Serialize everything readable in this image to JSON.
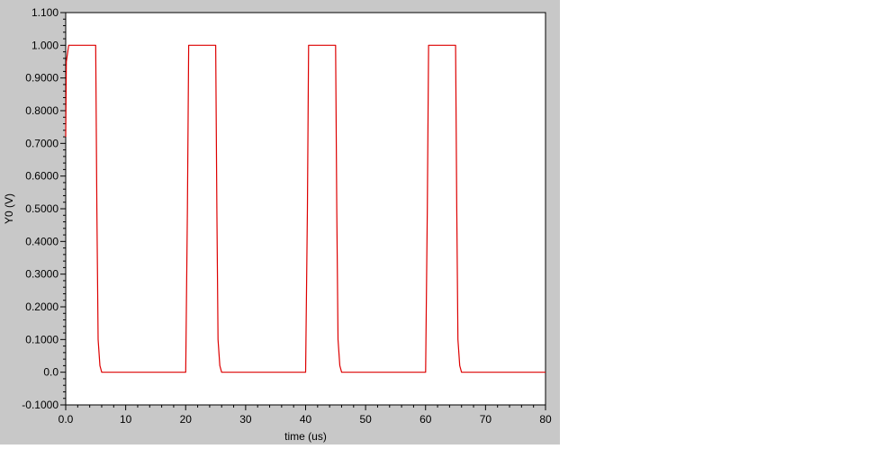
{
  "colors": {
    "panel": "#c8c8c8",
    "plot_bg": "#ffffff",
    "trace": "#dd0000"
  },
  "chart_data": {
    "type": "line",
    "xlabel": "time (us)",
    "ylabel": "Y0 (V)",
    "xlim": [
      0,
      80
    ],
    "ylim": [
      -0.1,
      1.1
    ],
    "x_ticks": [
      0,
      10,
      20,
      30,
      40,
      50,
      60,
      70,
      80
    ],
    "x_tick_labels": [
      "0.0",
      "10",
      "20",
      "30",
      "40",
      "50",
      "60",
      "70",
      "80"
    ],
    "y_ticks": [
      1.1,
      1.0,
      0.9,
      0.8,
      0.7,
      0.6,
      0.5,
      0.4,
      0.3,
      0.2,
      0.1,
      0.0,
      -0.1
    ],
    "y_tick_labels": [
      "1.100",
      "1.000",
      "0.9000",
      "0.8000",
      "0.7000",
      "0.6000",
      "0.5000",
      "0.4000",
      "0.3000",
      "0.2000",
      "0.1000",
      "0.0",
      "-0.1000"
    ],
    "grid": false,
    "series": [
      {
        "color": "#dd0000",
        "x": [
          0,
          0.1,
          0.5,
          5.0,
          5.2,
          5.4,
          5.7,
          6.0,
          20.0,
          20.3,
          20.5,
          25.0,
          25.2,
          25.4,
          25.7,
          26.0,
          40.0,
          40.3,
          40.5,
          45.0,
          45.2,
          45.4,
          45.7,
          46.0,
          60.0,
          60.3,
          60.5,
          65.0,
          65.2,
          65.4,
          65.7,
          66.0,
          80.0
        ],
        "y": [
          0.72,
          0.95,
          1.0,
          1.0,
          0.5,
          0.1,
          0.02,
          0.0,
          0.0,
          0.5,
          1.0,
          1.0,
          0.5,
          0.1,
          0.02,
          0.0,
          0.0,
          0.5,
          1.0,
          1.0,
          0.5,
          0.1,
          0.02,
          0.0,
          0.0,
          0.5,
          1.0,
          1.0,
          0.5,
          0.1,
          0.02,
          0.0,
          0.0
        ]
      }
    ]
  }
}
